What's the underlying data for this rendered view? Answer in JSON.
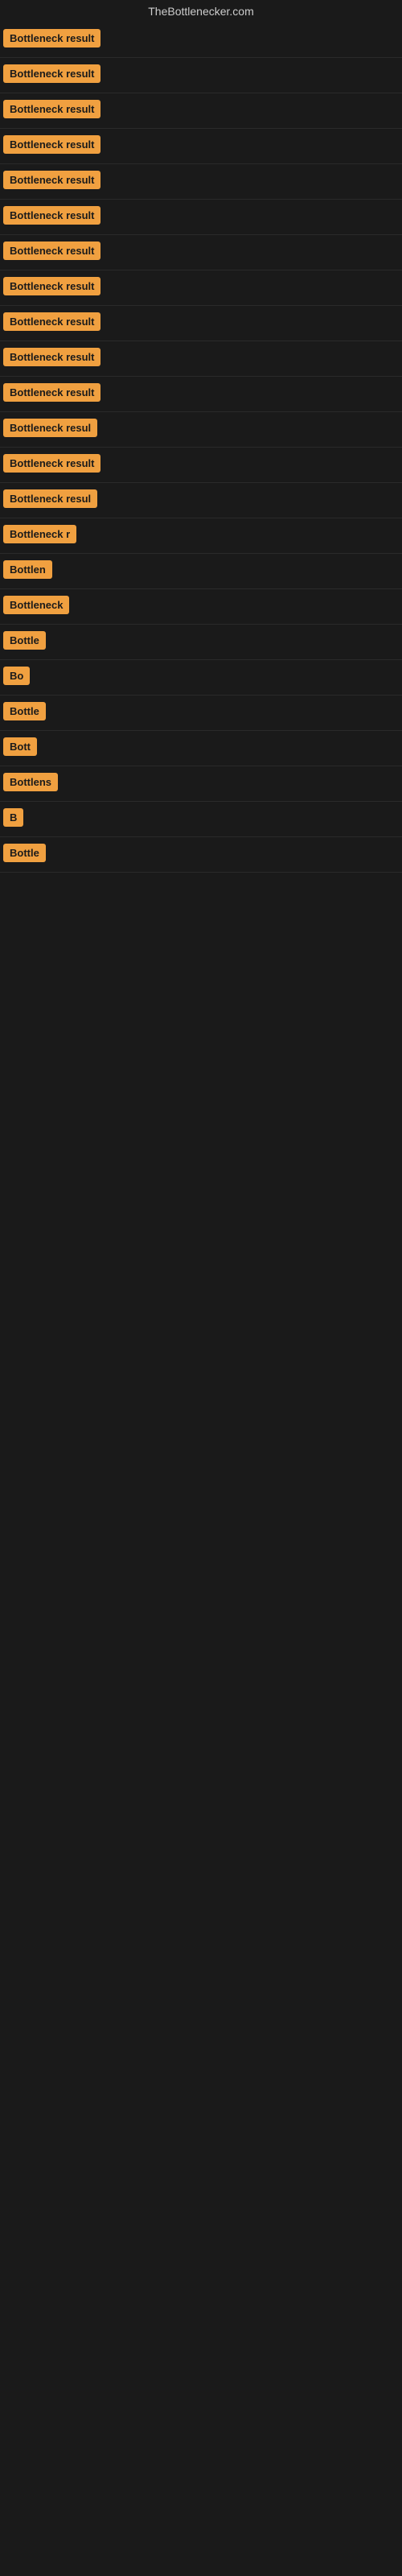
{
  "site": {
    "title": "TheBottlenecker.com"
  },
  "rows": [
    {
      "id": 1,
      "label": "Bottleneck result",
      "truncated": false
    },
    {
      "id": 2,
      "label": "Bottleneck result",
      "truncated": false
    },
    {
      "id": 3,
      "label": "Bottleneck result",
      "truncated": false
    },
    {
      "id": 4,
      "label": "Bottleneck result",
      "truncated": false
    },
    {
      "id": 5,
      "label": "Bottleneck result",
      "truncated": false
    },
    {
      "id": 6,
      "label": "Bottleneck result",
      "truncated": false
    },
    {
      "id": 7,
      "label": "Bottleneck result",
      "truncated": false
    },
    {
      "id": 8,
      "label": "Bottleneck result",
      "truncated": false
    },
    {
      "id": 9,
      "label": "Bottleneck result",
      "truncated": false
    },
    {
      "id": 10,
      "label": "Bottleneck result",
      "truncated": false
    },
    {
      "id": 11,
      "label": "Bottleneck result",
      "truncated": false
    },
    {
      "id": 12,
      "label": "Bottleneck resul",
      "truncated": true
    },
    {
      "id": 13,
      "label": "Bottleneck result",
      "truncated": false
    },
    {
      "id": 14,
      "label": "Bottleneck resul",
      "truncated": true
    },
    {
      "id": 15,
      "label": "Bottleneck r",
      "truncated": true
    },
    {
      "id": 16,
      "label": "Bottlen",
      "truncated": true
    },
    {
      "id": 17,
      "label": "Bottleneck",
      "truncated": true
    },
    {
      "id": 18,
      "label": "Bottle",
      "truncated": true
    },
    {
      "id": 19,
      "label": "Bo",
      "truncated": true
    },
    {
      "id": 20,
      "label": "Bottle",
      "truncated": true
    },
    {
      "id": 21,
      "label": "Bott",
      "truncated": true
    },
    {
      "id": 22,
      "label": "Bottlens",
      "truncated": true
    },
    {
      "id": 23,
      "label": "B",
      "truncated": true
    },
    {
      "id": 24,
      "label": "Bottle",
      "truncated": true
    }
  ]
}
